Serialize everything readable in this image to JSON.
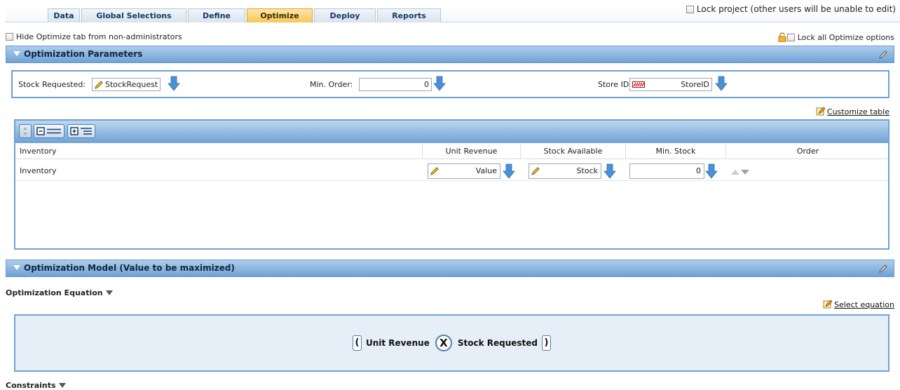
{
  "tabs": [
    "Data",
    "Global Selections",
    "Define",
    "Optimize",
    "Deploy",
    "Reports"
  ],
  "active_tab": "Optimize",
  "lock_project_label": "Lock project (other users will be unable to edit)",
  "hide_tab_label": "Hide Optimize tab from non-administrators",
  "lock_all_label": "Lock all Optimize options",
  "sections": {
    "params": "Optimization Parameters",
    "model": "Optimization Model (Value to be maximized)"
  },
  "params": {
    "stock_requested_label": "Stock Requested:",
    "stock_requested_value": "StockRequest",
    "min_order_label": "Min. Order:",
    "min_order_value": "0",
    "store_id_label": "Store ID:",
    "store_id_value": "StoreID"
  },
  "customize_label": "Customize table",
  "table": {
    "columns": [
      "Inventory",
      "Unit Revenue",
      "Stock Available",
      "Min. Stock",
      "Order"
    ],
    "row": {
      "name": "Inventory",
      "unit_revenue": "Value",
      "stock_available": "Stock",
      "min_stock": "0"
    }
  },
  "equation_label": "Optimization Equation",
  "select_equation_label": "Select equation",
  "equation": {
    "open": "(",
    "term1": "Unit Revenue",
    "operator": "X",
    "term2": "Stock Requested",
    "close": ")"
  },
  "constraints_label": "Constraints",
  "colors": {
    "header_blue": "#6ea2d6",
    "active_tab": "#f7c75a",
    "arrow_blue": "#4a90d9"
  }
}
